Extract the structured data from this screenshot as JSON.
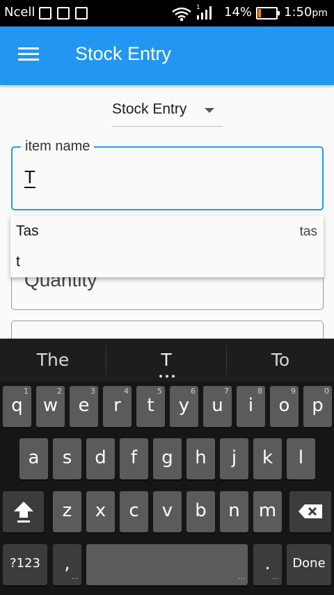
{
  "status_bar": {
    "carrier": "Ncell",
    "battery_percent": "14%",
    "battery_level": 0.14,
    "time": "1:50",
    "time_suffix": "pm",
    "battery_color": "#ff8a00"
  },
  "app_bar": {
    "title": "Stock Entry",
    "color": "#2196f3"
  },
  "form": {
    "entry_type": {
      "selected": "Stock Entry"
    },
    "item_name": {
      "label": "item name",
      "value": "T"
    },
    "quantity": {
      "placeholder": "Quantity"
    }
  },
  "autocomplete": {
    "suggestions": [
      {
        "text": "Tas",
        "hint": "tas"
      },
      {
        "text": "t",
        "hint": ""
      }
    ]
  },
  "keyboard": {
    "candidates": [
      "The",
      "T",
      "To"
    ],
    "row1": [
      {
        "key": "q",
        "hint": "1"
      },
      {
        "key": "w",
        "hint": "2"
      },
      {
        "key": "e",
        "hint": "3"
      },
      {
        "key": "r",
        "hint": "4"
      },
      {
        "key": "t",
        "hint": "5"
      },
      {
        "key": "y",
        "hint": "6"
      },
      {
        "key": "u",
        "hint": "7"
      },
      {
        "key": "i",
        "hint": "8"
      },
      {
        "key": "o",
        "hint": "9"
      },
      {
        "key": "p",
        "hint": "0"
      }
    ],
    "row2": [
      "a",
      "s",
      "d",
      "f",
      "g",
      "h",
      "j",
      "k",
      "l"
    ],
    "row3": [
      "z",
      "x",
      "c",
      "v",
      "b",
      "n",
      "m"
    ],
    "symbols_label": "?123",
    "comma_label": ",",
    "period_label": ".",
    "done_label": "Done",
    "shift_icon": "shift-arrow-icon",
    "backspace_icon": "backspace-icon"
  }
}
